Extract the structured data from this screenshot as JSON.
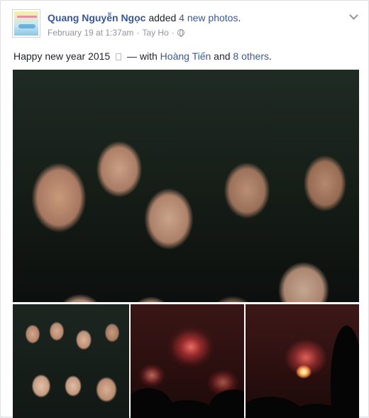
{
  "post": {
    "author": "Quang Nguyễn Ngọc",
    "action_prefix": "added",
    "photo_count_text": "4 new photos",
    "action_suffix": ".",
    "date": "February 19 at 1:37am",
    "separator": "·",
    "location": "Tay Ho",
    "status_text": "Happy new year 2015",
    "with_prefix": "— with",
    "tagged_person": "Hoàng Tiến",
    "and_text": "and",
    "others_text": "8 others",
    "period": "."
  },
  "icons": {
    "privacy": "globe-icon",
    "options": "chevron-down-icon",
    "emoji": "emoji-placeholder-icon"
  },
  "photos": [
    {
      "alt": "group selfie"
    },
    {
      "alt": "group selfie thumbnail"
    },
    {
      "alt": "fireworks"
    },
    {
      "alt": "fireworks"
    }
  ],
  "colors": {
    "link": "#365899",
    "text": "#1d2129",
    "meta": "#90949c"
  }
}
